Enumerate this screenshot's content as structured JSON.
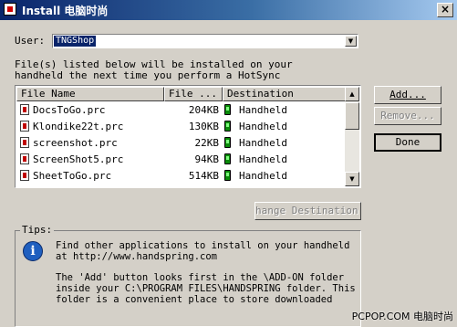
{
  "window": {
    "title": "Install 电脑时尚",
    "close_glyph": "×"
  },
  "user": {
    "label": "User:",
    "value": "TNGShop"
  },
  "intro": {
    "line1": "File(s) listed below will be installed on your",
    "line2": "handheld the next time you perform a HotSync"
  },
  "list": {
    "columns": [
      "File Name",
      "File ...",
      "Destination"
    ],
    "rows": [
      {
        "name": "DocsToGo.prc",
        "size": "204KB",
        "destination": "Handheld"
      },
      {
        "name": "Klondike22t.prc",
        "size": "130KB",
        "destination": "Handheld"
      },
      {
        "name": "screenshot.prc",
        "size": "22KB",
        "destination": "Handheld"
      },
      {
        "name": "ScreenShot5.prc",
        "size": "94KB",
        "destination": "Handheld"
      },
      {
        "name": "SheetToGo.prc",
        "size": "514KB",
        "destination": "Handheld"
      }
    ],
    "scroll_up": "▲",
    "scroll_down": "▼"
  },
  "buttons": {
    "add": "Add...",
    "remove": "Remove...",
    "done": "Done",
    "change_destination": "hange Destination..."
  },
  "tips": {
    "label": "Tips:",
    "icon_glyph": "i",
    "lines": [
      "Find other applications to install on your handheld",
      "at http://www.handspring.com",
      "The 'Add' button looks first in the \\ADD-ON folder",
      "inside your C:\\PROGRAM FILES\\HANDSPRING folder. This",
      "folder is a convenient place to store downloaded"
    ]
  },
  "watermark": "PCPOP.COM 电脑时尚",
  "colors": {
    "titlebar_start": "#0a246a",
    "titlebar_end": "#a6caf0",
    "face": "#d4d0c8",
    "selection": "#0a246a"
  }
}
